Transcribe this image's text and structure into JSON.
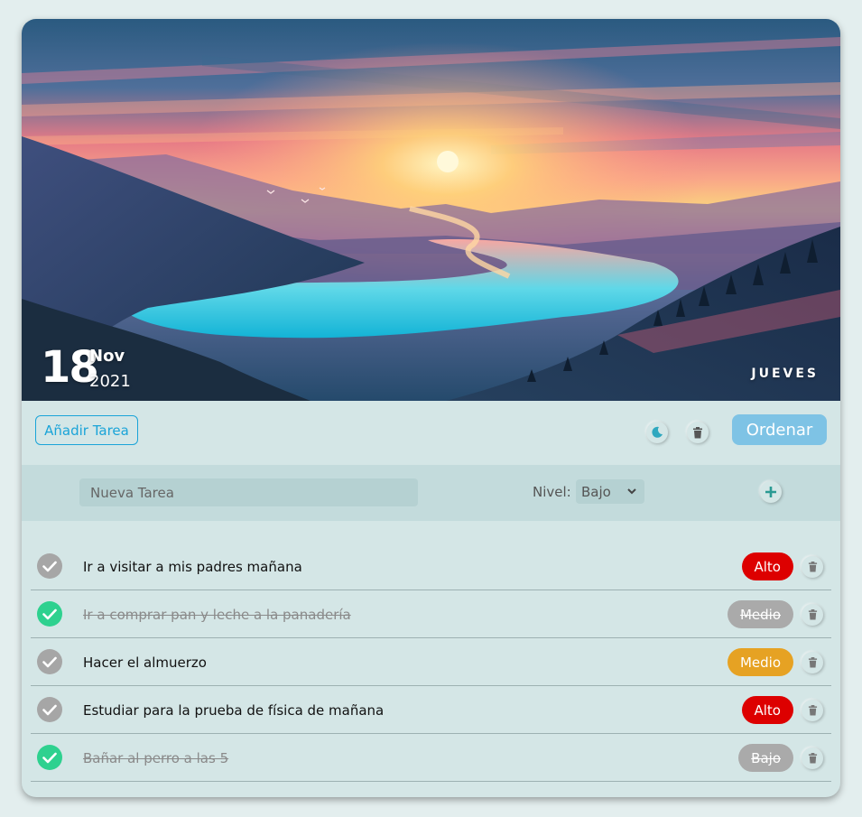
{
  "header": {
    "day": "18",
    "month": "Nov",
    "year": "2021",
    "weekday": "JUEVES"
  },
  "toolbar": {
    "add_label": "Añadir Tarea",
    "theme_icon": "moon-icon",
    "clear_icon": "trash-icon",
    "sort_label": "Ordenar"
  },
  "new_task": {
    "placeholder": "Nueva Tarea",
    "level_label": "Nivel:",
    "level_value": "Bajo",
    "add_icon": "plus-icon"
  },
  "colors": {
    "accent": "#1aa4d8",
    "sort_button": "#7ec3e5",
    "done_check": "#2ed18f",
    "todo_check": "#a6a6a6",
    "alto": "#dd0000",
    "medio": "#e6a223",
    "completed_badge": "#aaaaaa"
  },
  "tasks": [
    {
      "text": "Ir a visitar a mis padres mañana",
      "level": "Alto",
      "done": false
    },
    {
      "text": "Ir a comprar pan y leche a la panadería",
      "level": "Medio",
      "done": true
    },
    {
      "text": "Hacer el almuerzo",
      "level": "Medio",
      "done": false
    },
    {
      "text": "Estudiar para la prueba de física de mañana",
      "level": "Alto",
      "done": false
    },
    {
      "text": "Bañar al perro a las 5",
      "level": "Bajo",
      "done": true
    }
  ]
}
